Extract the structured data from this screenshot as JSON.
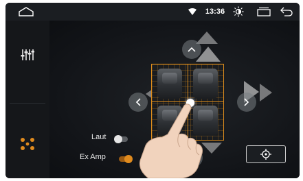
{
  "status_bar": {
    "time": "13:36",
    "icons": [
      "home-outline-icon",
      "wifi-icon",
      "brightness-icon",
      "recent-apps-icon",
      "back-arrow-icon"
    ]
  },
  "sidebar": {
    "items": [
      {
        "name": "equalizer",
        "icon": "equalizer-sliders-icon",
        "selected": false
      },
      {
        "name": "fader-balance",
        "icon": "speaker-dots-icon",
        "selected": true
      }
    ]
  },
  "main": {
    "toggles": [
      {
        "label": "Laut",
        "on": false
      },
      {
        "label": "Ex Amp",
        "on": true
      }
    ],
    "controls": {
      "up": "chevron-up-icon",
      "down": "chevron-down-icon",
      "left": "chevron-left-icon",
      "right": "chevron-right-icon",
      "center": "crosshair-icon"
    }
  },
  "colors": {
    "accent": "#e08b1e",
    "background": "#0d0f12",
    "status_bar": "#1b1e22",
    "sidebar": "#15171a"
  }
}
